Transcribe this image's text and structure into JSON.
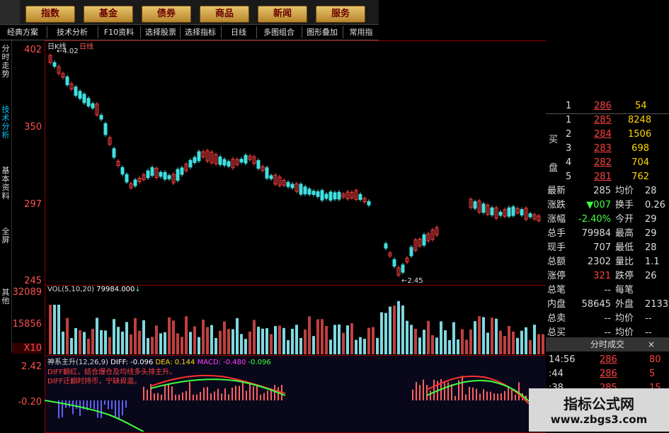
{
  "menu": {
    "items": [
      "指数",
      "基金",
      "债券",
      "商品",
      "新闻",
      "服务"
    ]
  },
  "toolbar": {
    "items": [
      "经典方案",
      "技术分析",
      "F10资料",
      "选择股票",
      "选择指标",
      "日线",
      "多图组合",
      "图形叠加",
      "常用指"
    ]
  },
  "side_tabs": [
    "分时走势",
    "技术分析",
    "基本资料",
    "全屏",
    "其他"
  ],
  "main_chart": {
    "title": "日K线",
    "subtitle": "日线",
    "high_marker": "4.02",
    "low_marker": "2.45",
    "y_ticks": [
      "402",
      "350",
      "297",
      "245"
    ]
  },
  "volume": {
    "header": "VOL(5,10,20)",
    "value": "79984.000",
    "y_ticks": [
      "32089",
      "15856",
      "X10"
    ]
  },
  "indicator": {
    "name": "神系主升(12,26,9)",
    "diff": "DIFF: -0.096",
    "dea": "DEA: 0.144",
    "macd": "MACD: -0.480",
    "extra": "-0.096",
    "note1": "DIFF翻红，结合爆仓及均线多头排主升。",
    "note2": "DIFF迁翻时持币，宁缺毋滥。",
    "y_ticks": [
      "2.42",
      "-0.20"
    ]
  },
  "orderbook": {
    "top_row": {
      "level": "1",
      "price": "286",
      "vol": "54"
    },
    "buy_label": "买盘",
    "rows": [
      {
        "level": "1",
        "price": "285",
        "vol": "8248"
      },
      {
        "level": "2",
        "price": "284",
        "vol": "1506"
      },
      {
        "level": "3",
        "price": "283",
        "vol": "698"
      },
      {
        "level": "4",
        "price": "282",
        "vol": "704"
      },
      {
        "level": "5",
        "price": "281",
        "vol": "762"
      }
    ]
  },
  "quote": [
    {
      "l1": "最新",
      "v1": "285",
      "l2": "均价",
      "v2": "28"
    },
    {
      "l1": "涨跌",
      "v1": "▼007",
      "l2": "换手",
      "v2": "0.26"
    },
    {
      "l1": "涨幅",
      "v1": "-2.40%",
      "l2": "今开",
      "v2": "29"
    },
    {
      "l1": "总手",
      "v1": "79984",
      "l2": "最高",
      "v2": "29"
    },
    {
      "l1": "现手",
      "v1": "707",
      "l2": "最低",
      "v2": "28"
    },
    {
      "l1": "总额",
      "v1": "2302",
      "l2": "量比",
      "v2": "1.1"
    },
    {
      "l1": "涨停",
      "v1": "321",
      "l2": "跌停",
      "v2": "26"
    },
    {
      "l1": "总笔",
      "v1": "--",
      "l2": "每笔",
      "v2": ""
    },
    {
      "l1": "内盘",
      "v1": "58645",
      "l2": "外盘",
      "v2": "2133"
    },
    {
      "l1": "总卖",
      "v1": "--",
      "l2": "均价",
      "v2": "--"
    },
    {
      "l1": "总买",
      "v1": "--",
      "l2": "均价",
      "v2": "--"
    }
  ],
  "ticks_panel": {
    "title": "分时成交",
    "rows": [
      {
        "time": "14:56",
        "price": "286",
        "vol": "80"
      },
      {
        "time": ":44",
        "price": "286",
        "vol": "5"
      },
      {
        "time": ":38",
        "price": "285",
        "vol": "15"
      }
    ]
  },
  "watermark": {
    "line1": "指标公式网",
    "line2": "www.zbgs3.com"
  },
  "colors": {
    "up": "#ff4040",
    "down": "#40e0e0",
    "grid": "#8b0000",
    "yellow": "#ffd700"
  }
}
